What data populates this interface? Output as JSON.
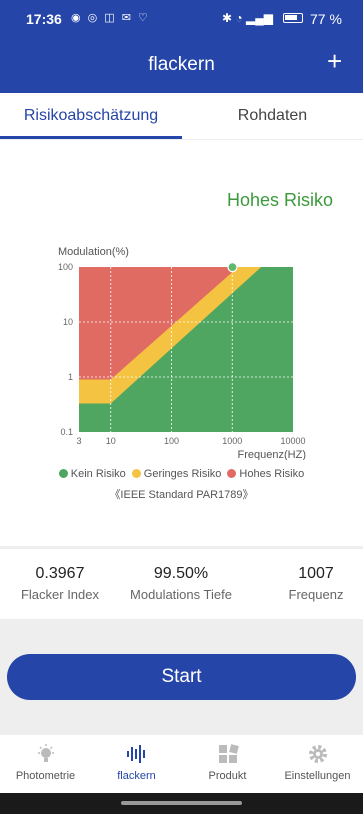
{
  "status": {
    "time": "17:36",
    "battery": "77 %",
    "battery_level": 0.77
  },
  "appbar": {
    "title": "flackern",
    "add_icon": "+"
  },
  "tabs": [
    {
      "label": "Risikoabschätzung"
    },
    {
      "label": "Rohdaten"
    }
  ],
  "risk_label": "Hohes Risiko",
  "chart_data": {
    "type": "scatter",
    "ylabel": "Modulation(%)",
    "xlabel": "Frequenz(HZ)",
    "x_scale": "log",
    "y_scale": "log",
    "x_ticks": [
      "3",
      "10",
      "100",
      "1000",
      "10000"
    ],
    "y_ticks": [
      "100",
      "10",
      "1",
      "0.1"
    ],
    "xlim": [
      3,
      10000
    ],
    "ylim": [
      0.1,
      100
    ],
    "grid": true,
    "regions": [
      {
        "name": "Kein Risiko",
        "color": "#4ea660"
      },
      {
        "name": "Geringes Risiko",
        "color": "#f5c342"
      },
      {
        "name": "Hohes Risiko",
        "color": "#e06b62"
      }
    ],
    "point": {
      "x": 1007,
      "y": 99.5,
      "color": "#5fb870"
    }
  },
  "legend": [
    {
      "label": "Kein Risiko",
      "color": "#4ea660"
    },
    {
      "label": "Geringes Risiko",
      "color": "#f5c342"
    },
    {
      "label": "Hohes Risiko",
      "color": "#e06b62"
    }
  ],
  "standard": "《IEEE Standard PAR1789》",
  "stats": [
    {
      "value": "0.3967",
      "label": "Flacker Index"
    },
    {
      "value": "99.50%",
      "label": "Modulations Tiefe"
    },
    {
      "value": "1007",
      "label": "Frequenz"
    }
  ],
  "start_label": "Start",
  "nav": [
    {
      "label": "Photometrie",
      "icon": "bulb-icon"
    },
    {
      "label": "flackern",
      "icon": "flicker-icon"
    },
    {
      "label": "Produkt",
      "icon": "grid-icon"
    },
    {
      "label": "Einstellungen",
      "icon": "gear-icon"
    }
  ]
}
